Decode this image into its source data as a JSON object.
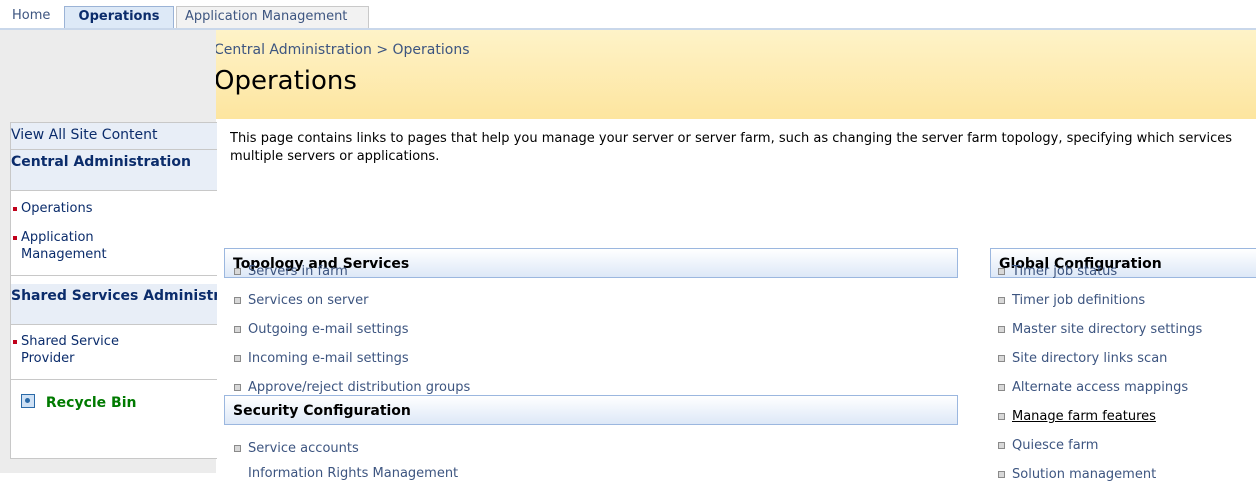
{
  "tabs": [
    {
      "label": "Home"
    },
    {
      "label": "Operations"
    },
    {
      "label": "Application Management"
    }
  ],
  "leftnav": {
    "view_all": "View All Site Content",
    "central_admin": {
      "header": "Central Administration",
      "items": [
        "Operations",
        "Application Management"
      ]
    },
    "shared_services": {
      "header": "Shared Services Administration",
      "items": [
        "Shared Service Provider"
      ]
    },
    "recycle_bin": "Recycle Bin"
  },
  "title_area": {
    "breadcrumb": [
      "Central Administration",
      "Operations"
    ],
    "breadcrumb_sep": ">",
    "title": "Operations"
  },
  "description": {
    "line1": "This page contains links to pages that help you manage your server or server farm, such as changing the server farm topology, specifying which services",
    "line2": "multiple servers or applications."
  },
  "sections": {
    "topology": {
      "heading": "Topology and Services",
      "links": [
        "Servers in farm",
        "Services on server",
        "Outgoing e-mail settings",
        "Incoming e-mail settings",
        "Approve/reject distribution groups"
      ]
    },
    "security": {
      "heading": "Security Configuration",
      "links": [
        "Service accounts",
        "Information Rights Management"
      ]
    },
    "global": {
      "heading": "Global Configuration",
      "links": [
        "Timer job status",
        "Timer job definitions",
        "Master site directory settings",
        "Site directory links scan",
        "Alternate access mappings",
        "Manage farm features",
        "Quiesce farm",
        "Solution management"
      ]
    }
  },
  "colors": {
    "link": "#3d5580",
    "nav_header": "#0b2c6b",
    "recycle": "#007a00",
    "title_bg": "#fde59f",
    "section_border": "#9bb7df"
  }
}
